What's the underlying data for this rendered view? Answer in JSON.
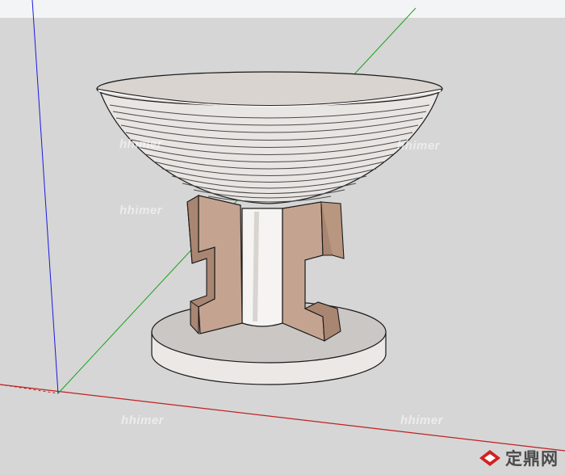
{
  "watermarks": {
    "text": "hhimer"
  },
  "brand": {
    "text": "定鼎网"
  },
  "colors": {
    "background": "#d6d6d6",
    "sky": "#f2f4f6",
    "red_axis": "#c02020",
    "green_axis": "#1aa01a",
    "blue_axis": "#1a1ae0",
    "bowl_body": "#e9e5e2",
    "bowl_rim": "#d9d4d0",
    "bracket": "#c4a491",
    "bracket_shadow": "#a98672",
    "base_top": "#cbc7c4",
    "base_side": "#ebe8e6",
    "outline": "#1a1a1a",
    "brand_red": "#d32020"
  },
  "icons": {
    "brand_logo": "red-diamond-logo-icon"
  }
}
